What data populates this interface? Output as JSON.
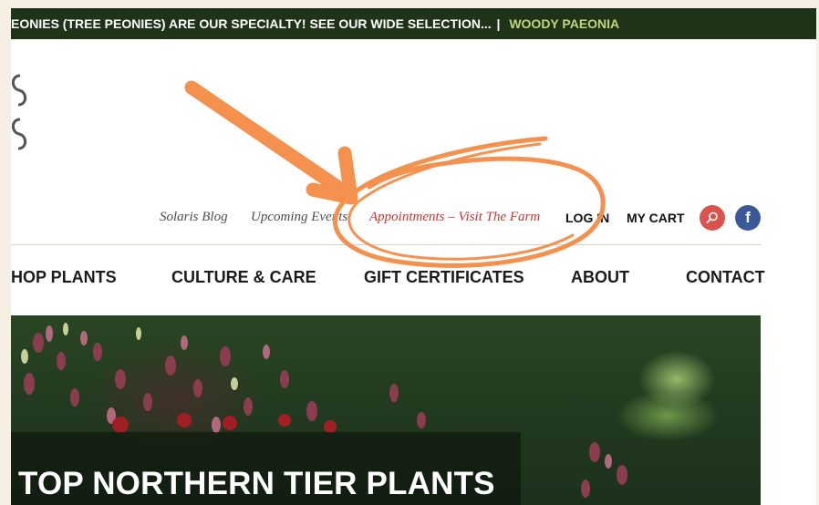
{
  "banner": {
    "message": "EONIES (TREE PEONIES) ARE OUR SPECIALTY! SEE OUR WIDE SELECTION...",
    "separator": "|",
    "brand_link": "WOODY PAEONIA"
  },
  "utility_nav": {
    "blog": "Solaris Blog",
    "events": "Upcoming Events",
    "appointments": "Appointments – Visit The Farm",
    "login": "LOG IN",
    "cart": "MY CART",
    "facebook_glyph": "f"
  },
  "main_nav": {
    "items": [
      "HOP PLANTS",
      "CULTURE & CARE",
      "GIFT CERTIFICATES",
      "ABOUT",
      "CONTACT"
    ]
  },
  "hero": {
    "title": "TOP NORTHERN TIER PLANTS"
  },
  "colors": {
    "banner_bg": "#1f3318",
    "banner_brand": "#bcd87c",
    "appointments_link": "#c8372f",
    "search_button": "#d9544f",
    "facebook_button": "#3b5998",
    "annotation_orange": "#f5914e"
  },
  "icons": [
    "search-icon",
    "facebook-icon",
    "arrow-annotation",
    "circle-annotation"
  ]
}
